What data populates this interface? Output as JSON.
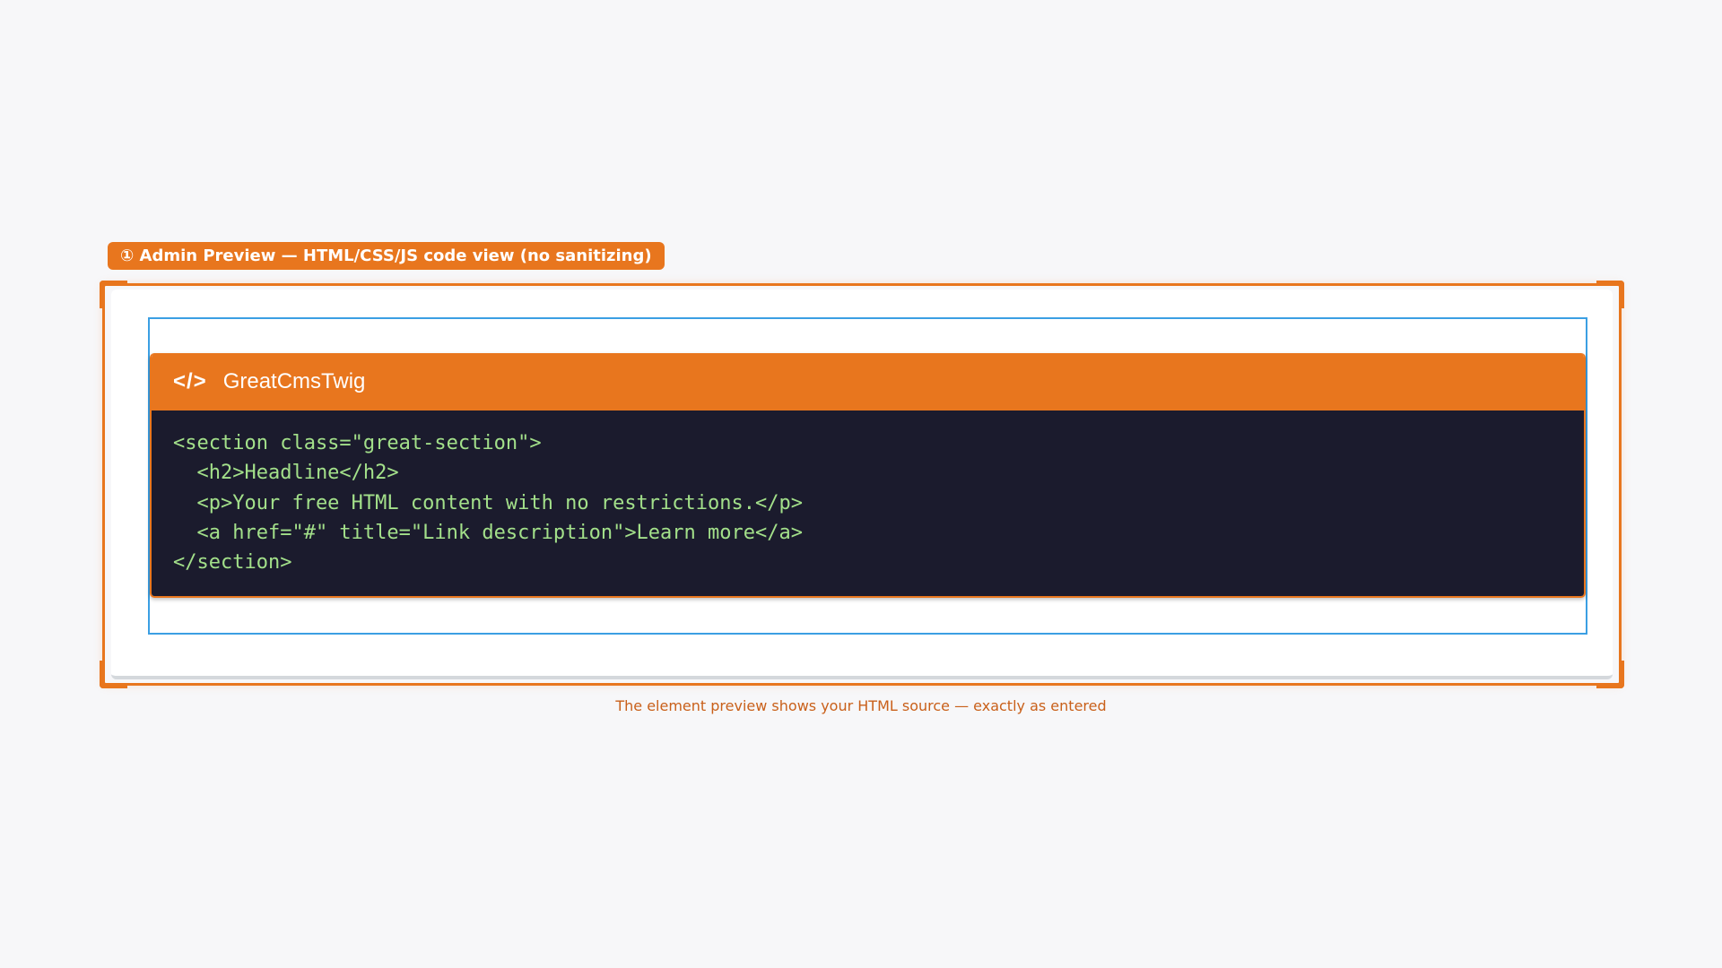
{
  "badge": {
    "text": "① Admin Preview  —  HTML/CSS/JS code view (no sanitizing)"
  },
  "code_card": {
    "icon": "code-icon",
    "icon_glyph": "</>",
    "title": "GreatCmsTwig",
    "lines": [
      "<section class=\"great-section\">",
      "  <h2>Headline</h2>",
      "  <p>Your free HTML content with no restrictions.</p>",
      "  <a href=\"#\" title=\"Link description\">Learn more</a>",
      "</section>"
    ]
  },
  "caption": "The element preview shows your HTML source — exactly as entered",
  "colors": {
    "accent": "#e8761e",
    "selection": "#3b9fe3",
    "code_bg": "#1b1b2d",
    "code_text": "#a3e08a",
    "caption": "#c9601a"
  }
}
